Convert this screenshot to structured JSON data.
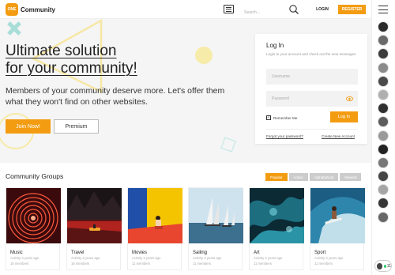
{
  "header": {
    "logo_badge": "ONE",
    "logo_text": "Community",
    "search_placeholder": "Search...",
    "login_label": "LOGIN",
    "register_label": "REGISTER"
  },
  "colors": {
    "accent": "#f39c12",
    "hero_bg": "#f5f5f5"
  },
  "hero": {
    "title_line1": "Ultimate solution",
    "title_line2": "for your community!",
    "text": "Members of your community deserve more. Let's offer them what they won't find on other websites.",
    "join_label": "Join Now!",
    "premium_label": "Premium"
  },
  "login": {
    "title": "Log In",
    "subtitle": "Login to your account and check out the new messages",
    "username_placeholder": "Username",
    "password_placeholder": "Password",
    "remember_label": "Remember Me",
    "submit_label": "Log In",
    "forgot_label": "Forgot your password?",
    "create_label": "Create New Account"
  },
  "groups": {
    "title": "Community Groups",
    "filters": [
      "Popular",
      "Active",
      "Alphabetical",
      "Newest"
    ],
    "active_filter": "Popular",
    "cards": [
      {
        "title": "Music",
        "meta1": "Activity 3 years ago",
        "meta2": "16 members"
      },
      {
        "title": "Travel",
        "meta1": "Activity 3 years ago",
        "meta2": "16 members"
      },
      {
        "title": "Movies",
        "meta1": "Activity 3 years ago",
        "meta2": "11 members"
      },
      {
        "title": "Sailing",
        "meta1": "Activity 3 years ago",
        "meta2": "11 members"
      },
      {
        "title": "Art",
        "meta1": "Activity 3 years ago",
        "meta2": "11 members"
      },
      {
        "title": "Sport",
        "meta1": "Activity 3 years ago",
        "meta2": "11 members"
      }
    ]
  },
  "rail": {
    "icons": [
      "menu-icon",
      "avatar"
    ],
    "chat_count": "11"
  }
}
